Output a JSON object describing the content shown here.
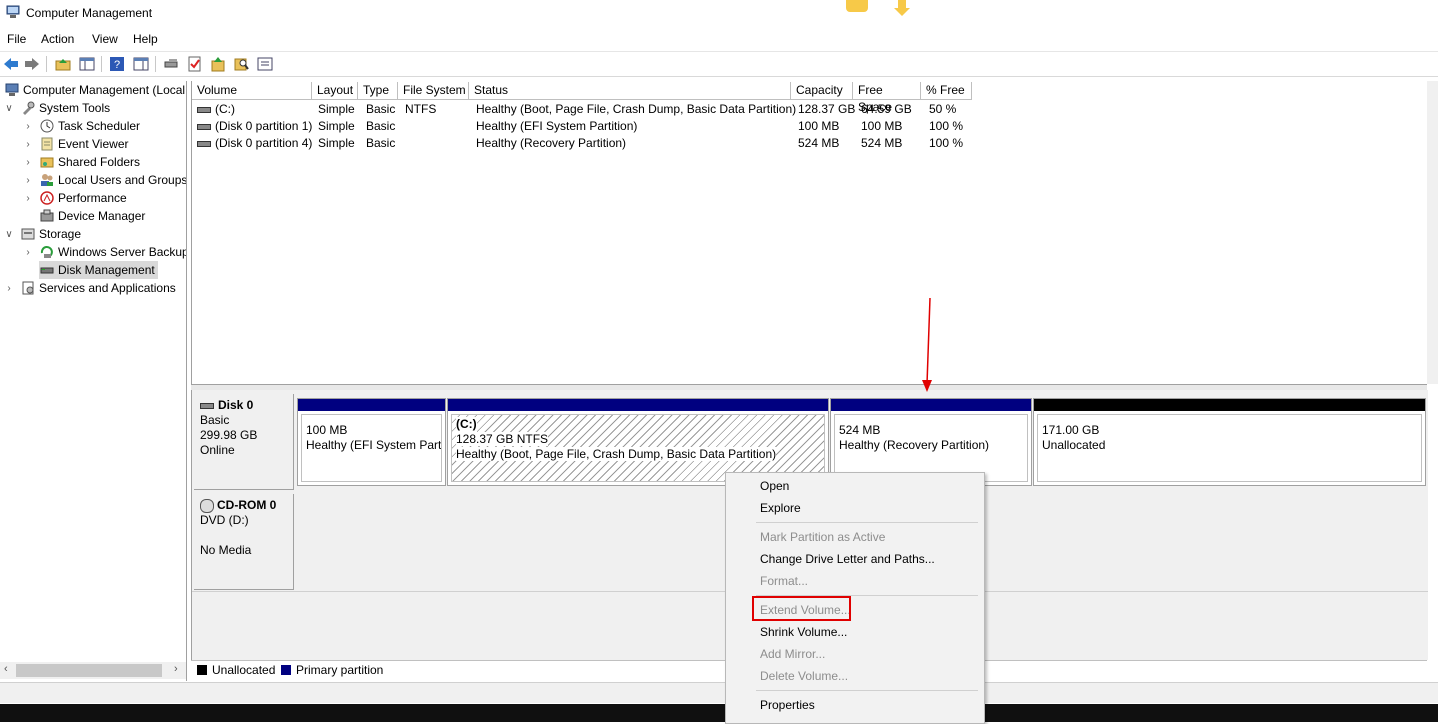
{
  "window": {
    "title": "Computer Management"
  },
  "menu": [
    "File",
    "Action",
    "View",
    "Help"
  ],
  "toolbar_icons": [
    "back-arrow-icon",
    "forward-arrow-icon",
    "up-folder-icon",
    "show-hide-tree-icon",
    "help-icon",
    "properties-pane-icon",
    "connect-icon",
    "check-icon",
    "rescan-icon",
    "search-icon",
    "list-icon"
  ],
  "tree": {
    "root": "Computer Management (Local",
    "items": [
      {
        "label": "System Tools",
        "level": 1,
        "expanded": true
      },
      {
        "label": "Task Scheduler",
        "level": 2
      },
      {
        "label": "Event Viewer",
        "level": 2
      },
      {
        "label": "Shared Folders",
        "level": 2
      },
      {
        "label": "Local Users and Groups",
        "level": 2
      },
      {
        "label": "Performance",
        "level": 2
      },
      {
        "label": "Device Manager",
        "level": 2
      },
      {
        "label": "Storage",
        "level": 1,
        "expanded": true
      },
      {
        "label": "Windows Server Backup",
        "level": 2
      },
      {
        "label": "Disk Management",
        "level": 2,
        "selected": true
      },
      {
        "label": "Services and Applications",
        "level": 1
      }
    ]
  },
  "volumes": {
    "columns": [
      "Volume",
      "Layout",
      "Type",
      "File System",
      "Status",
      "Capacity",
      "Free Space",
      "% Free"
    ],
    "rows": [
      [
        "(C:)",
        "Simple",
        "Basic",
        "NTFS",
        "Healthy (Boot, Page File, Crash Dump, Basic Data Partition)",
        "128.37 GB",
        "64.59 GB",
        "50 %"
      ],
      [
        "(Disk 0 partition 1)",
        "Simple",
        "Basic",
        "",
        "Healthy (EFI System Partition)",
        "100 MB",
        "100 MB",
        "100 %"
      ],
      [
        "(Disk 0 partition 4)",
        "Simple",
        "Basic",
        "",
        "Healthy (Recovery Partition)",
        "524 MB",
        "524 MB",
        "100 %"
      ]
    ]
  },
  "disks": {
    "disk0": {
      "name": "Disk 0",
      "type": "Basic",
      "size": "299.98 GB",
      "status": "Online",
      "partitions": [
        {
          "title": "",
          "line1": "100 MB",
          "line2": "Healthy (EFI System Partit",
          "kind": "primary"
        },
        {
          "title": "(C:)",
          "line1": "128.37 GB NTFS",
          "line2": "Healthy (Boot, Page File, Crash Dump, Basic Data Partition)",
          "kind": "primary"
        },
        {
          "title": "",
          "line1": "524 MB",
          "line2": "Healthy (Recovery Partition)",
          "kind": "primary"
        },
        {
          "title": "",
          "line1": "171.00 GB",
          "line2": "Unallocated",
          "kind": "unallocated"
        }
      ]
    },
    "cdrom0": {
      "name": "CD-ROM 0",
      "type": "DVD (D:)",
      "media": "No Media"
    }
  },
  "legend": {
    "unallocated": "Unallocated",
    "primary": "Primary partition"
  },
  "context_menu": {
    "items": [
      {
        "label": "Open",
        "enabled": true
      },
      {
        "label": "Explore",
        "enabled": true
      },
      {
        "label": "Mark Partition as Active",
        "enabled": false
      },
      {
        "label": "Change Drive Letter and Paths...",
        "enabled": true
      },
      {
        "label": "Format...",
        "enabled": false
      },
      {
        "label": "Extend Volume...",
        "enabled": false,
        "highlighted": true
      },
      {
        "label": "Shrink Volume...",
        "enabled": true
      },
      {
        "label": "Add Mirror...",
        "enabled": false
      },
      {
        "label": "Delete Volume...",
        "enabled": false
      },
      {
        "label": "Properties",
        "enabled": true
      }
    ]
  },
  "colors": {
    "primary": "#000080",
    "unallocated": "#000000",
    "annotation": "#e00000"
  }
}
